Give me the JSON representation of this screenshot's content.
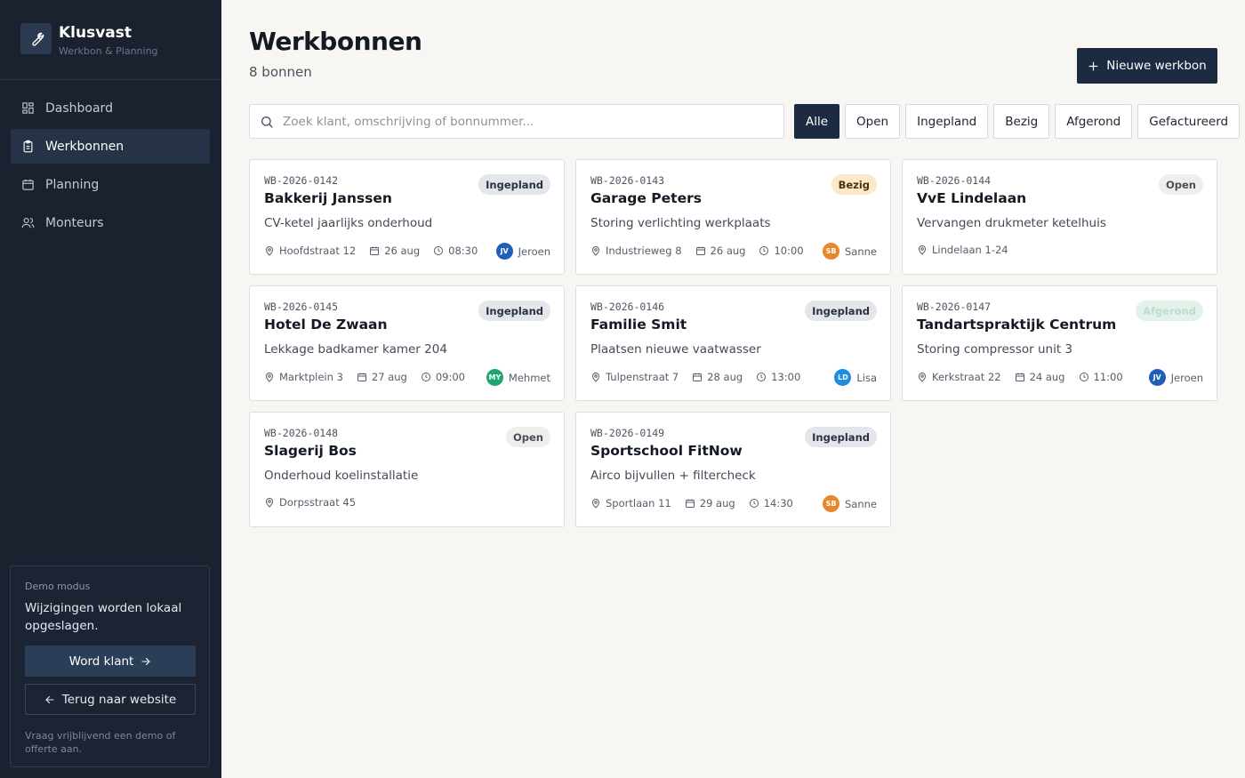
{
  "brand": {
    "name": "Klusvast",
    "subtitle": "Werkbon & Planning"
  },
  "nav": [
    {
      "label": "Dashboard",
      "icon": "dashboard-icon",
      "active": false
    },
    {
      "label": "Werkbonnen",
      "icon": "clipboard-icon",
      "active": true
    },
    {
      "label": "Planning",
      "icon": "calendar-icon",
      "active": false
    },
    {
      "label": "Monteurs",
      "icon": "users-icon",
      "active": false
    }
  ],
  "demo": {
    "label": "Demo modus",
    "text": "Wijzigingen worden lokaal opgeslagen.",
    "primary_button": "Word klant",
    "secondary_button": "Terug naar website",
    "footnote": "Vraag vrijblijvend een demo of offerte aan."
  },
  "header": {
    "title": "Werkbonnen",
    "count": "8 bonnen",
    "new_button": "Nieuwe werkbon"
  },
  "search": {
    "placeholder": "Zoek klant, omschrijving of bonnummer...",
    "value": ""
  },
  "filters": [
    {
      "label": "Alle",
      "active": true
    },
    {
      "label": "Open",
      "active": false
    },
    {
      "label": "Ingepland",
      "active": false
    },
    {
      "label": "Bezig",
      "active": false
    },
    {
      "label": "Afgerond",
      "active": false
    },
    {
      "label": "Gefactureerd",
      "active": false
    }
  ],
  "colors": {
    "sidebar_bg": "#1a2230",
    "primary": "#1c2b42",
    "avatar_jeroen": "#1f5fb8",
    "avatar_sanne": "#e8862a",
    "avatar_mehmet": "#1ea672",
    "avatar_lisa": "#1d8ce0"
  },
  "workorders": [
    {
      "number": "WB-2026-0142",
      "client": "Bakkerij Janssen",
      "description": "CV-ketel jaarlijks onderhoud",
      "status": "Ingepland",
      "status_key": "ingepland",
      "address": "Hoofdstraat 12",
      "date": "26 aug",
      "time": "08:30",
      "assignee": "Jeroen",
      "initials": "JV",
      "avatar_color": "#1f5fb8"
    },
    {
      "number": "WB-2026-0143",
      "client": "Garage Peters",
      "description": "Storing verlichting werkplaats",
      "status": "Bezig",
      "status_key": "bezig",
      "address": "Industrieweg 8",
      "date": "26 aug",
      "time": "10:00",
      "assignee": "Sanne",
      "initials": "SB",
      "avatar_color": "#e8862a"
    },
    {
      "number": "WB-2026-0144",
      "client": "VvE Lindelaan",
      "description": "Vervangen drukmeter ketelhuis",
      "status": "Open",
      "status_key": "open",
      "address": "Lindelaan 1-24",
      "date": "",
      "time": "",
      "assignee": "",
      "initials": "",
      "avatar_color": ""
    },
    {
      "number": "WB-2026-0145",
      "client": "Hotel De Zwaan",
      "description": "Lekkage badkamer kamer 204",
      "status": "Ingepland",
      "status_key": "ingepland",
      "address": "Marktplein 3",
      "date": "27 aug",
      "time": "09:00",
      "assignee": "Mehmet",
      "initials": "MY",
      "avatar_color": "#1ea672"
    },
    {
      "number": "WB-2026-0146",
      "client": "Familie Smit",
      "description": "Plaatsen nieuwe vaatwasser",
      "status": "Ingepland",
      "status_key": "ingepland",
      "address": "Tulpenstraat 7",
      "date": "28 aug",
      "time": "13:00",
      "assignee": "Lisa",
      "initials": "LD",
      "avatar_color": "#1d8ce0"
    },
    {
      "number": "WB-2026-0147",
      "client": "Tandartspraktijk Centrum",
      "description": "Storing compressor unit 3",
      "status": "Afgerond",
      "status_key": "afgerond",
      "address": "Kerkstraat 22",
      "date": "24 aug",
      "time": "11:00",
      "assignee": "Jeroen",
      "initials": "JV",
      "avatar_color": "#1f5fb8"
    },
    {
      "number": "WB-2026-0148",
      "client": "Slagerij Bos",
      "description": "Onderhoud koelinstallatie",
      "status": "Open",
      "status_key": "open",
      "address": "Dorpsstraat 45",
      "date": "",
      "time": "",
      "assignee": "",
      "initials": "",
      "avatar_color": ""
    },
    {
      "number": "WB-2026-0149",
      "client": "Sportschool FitNow",
      "description": "Airco bijvullen + filtercheck",
      "status": "Ingepland",
      "status_key": "ingepland",
      "address": "Sportlaan 11",
      "date": "29 aug",
      "time": "14:30",
      "assignee": "Sanne",
      "initials": "SB",
      "avatar_color": "#e8862a"
    }
  ]
}
